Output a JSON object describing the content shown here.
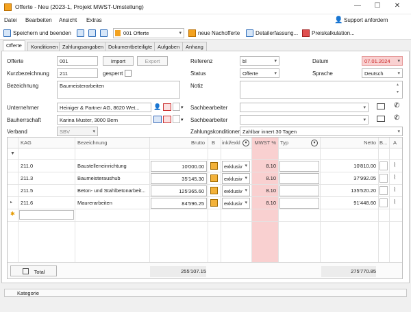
{
  "window": {
    "title": "Offerte - Neu (2023-1, Projekt MWST-Umstellung)",
    "minimize": "—",
    "maximize": "☐",
    "close": "✕"
  },
  "menu": {
    "items": [
      "Datei",
      "Bearbeiten",
      "Ansicht",
      "Extras"
    ],
    "support": "Support anfordern"
  },
  "toolbar": {
    "save_close": "Speichern und beenden",
    "offer_select": "001 Offerte",
    "new_offer": "neue Nachofferte",
    "detail": "Detailerfassung...",
    "price_calc": "Preiskalkulation..."
  },
  "tabs": [
    "Offerte",
    "Konditionen",
    "Zahlungsangaben",
    "Dokumentbeteiligte",
    "Aufgaben",
    "Anhang"
  ],
  "form": {
    "offerte_label": "Offerte",
    "offerte_value": "001",
    "import_btn": "Import",
    "export_btn": "Export",
    "kurz_label": "Kurzbezeichnung",
    "kurz_value": "211",
    "gesperrt_label": "gesperrt",
    "bez_label": "Bezeichnung",
    "bez_value": "Baumeisterarbeiten",
    "unternehmer_label": "Unternehmer",
    "unternehmer_value": "Heiniger & Partner AG, 8620 Wet...",
    "bauherr_label": "Bauherrschaft",
    "bauherr_value": "Karina Muster, 3000 Bern",
    "verband_label": "Verband",
    "verband_value": "SBV",
    "referenz_label": "Referenz",
    "referenz_value": "bl",
    "status_label": "Status",
    "status_value": "Offerte",
    "notiz_label": "Notiz",
    "datum_label": "Datum",
    "datum_value": "07.01.2024",
    "sprache_label": "Sprache",
    "sprache_value": "Deutsch",
    "sach1_label": "Sachbearbeiter",
    "sach2_label": "Sachbearbeiter",
    "zahl_label": "Zahlungskonditionen",
    "zahl_value": "Zahlbar innert 30 Tagen"
  },
  "grid": {
    "headers": {
      "kag": "KAG",
      "bez": "Bezeichnung",
      "brutto": "Brutto",
      "b": "B",
      "inkl": "inkl/exkl",
      "mwst": "MWST %",
      "typ": "Typ",
      "netto": "Netto",
      "b2": "B...",
      "a": "A"
    },
    "rows": [
      {
        "kag": "211.0",
        "bez": "Baustelleneinrichtung",
        "brutto": "10'000.00",
        "inkl": "exklusiv",
        "mwst": "8.10",
        "netto": "10'810.00"
      },
      {
        "kag": "211.3",
        "bez": "Baumeisteraushub",
        "brutto": "35'145.30",
        "inkl": "exklusiv",
        "mwst": "8.10",
        "netto": "37'992.05"
      },
      {
        "kag": "211.5",
        "bez": "Beton- und Stahlbetonarbeit...",
        "brutto": "125'365.60",
        "inkl": "exklusiv",
        "mwst": "8.10",
        "netto": "135'520.20"
      },
      {
        "kag": "211.6",
        "bez": "Maurerarbeiten",
        "brutto": "84'596.25",
        "inkl": "exklusiv",
        "mwst": "8.10",
        "netto": "91'448.60"
      }
    ],
    "total_label": "Total",
    "total_brutto": "255'107.15",
    "total_netto": "275'770.85"
  },
  "statusbar": {
    "kategorie": "Kategorie"
  }
}
